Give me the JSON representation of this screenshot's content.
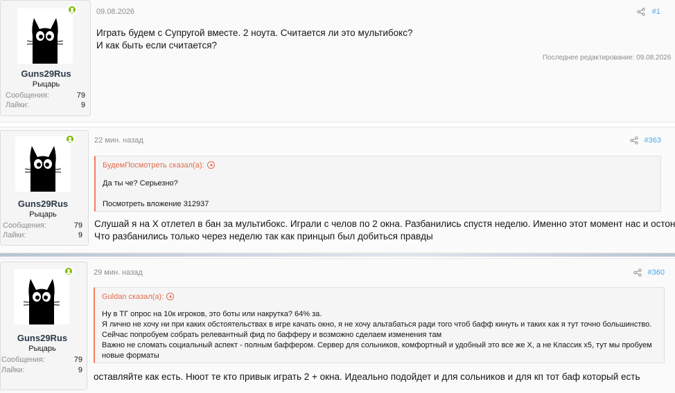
{
  "posts": [
    {
      "date": "09.08.2026",
      "number": "#1",
      "user": {
        "name": "Guns29Rus",
        "title": "Рыцарь",
        "messages_label": "Сообщения:",
        "messages": "79",
        "likes_label": "Лайки:",
        "likes": "9"
      },
      "lines": [
        "Играть будем с Супругой вместе. 2 ноута. Считается ли это мультибокс?",
        "И как быть если считается?"
      ],
      "edited": "Последнее редактирование: 09.08.2026"
    },
    {
      "date": "22 мин. назад",
      "number": "#363",
      "user": {
        "name": "Guns29Rus",
        "title": "Рыцарь",
        "messages_label": "Сообщения:",
        "messages": "79",
        "likes_label": "Лайки:",
        "likes": "9"
      },
      "quote": {
        "head": "БудемПосмотреть сказал(а):",
        "lines": [
          "Да ты че? Серьезно?",
          "Посмотреть вложение 312937"
        ]
      },
      "lines": [
        "Слушай я на Х отлетел в бан за мультибокс. Играли с челов по 2 окна. Разбанились спустя неделю. Именно этот момент нас и остоновил.",
        "Что разбанились только через неделю так как принцып был добиться правды"
      ]
    },
    {
      "date": "29 мин. назад",
      "number": "#360",
      "user": {
        "name": "Guns29Rus",
        "title": "Рыцарь",
        "messages_label": "Сообщения:",
        "messages": "79",
        "likes_label": "Лайки:",
        "likes": "9"
      },
      "quote": {
        "head": "Guldan сказал(а):",
        "lines": [
          "Ну в ТГ опрос на 10к игроков, это боты или накрутка? 64% за.",
          "Я лично не хочу ни при каких обстоятельствах в игре качать окно, я не хочу альтабаться ради того чтоб бафф кинуть и таких как я тут точно большинство.",
          "Сейчас попробуем собрать релевантный фид по бафферу и возможно сделаем изменения там",
          "Важно не сломать социальный аспект - полным баффером. Сервер для сольников, комфортный и удобный это все же Х, а не Классик х5, тут мы пробуем",
          "новые форматы"
        ]
      },
      "lines": [
        "оставляйте как есть. Нюот те кто привык играть 2 + окна. Идеально подойдет и для сольников и для кп тот баф который есть"
      ]
    }
  ],
  "colors": {
    "accent": "#47a7eb",
    "quote_accent": "#e26b4c",
    "online": "#7fb900"
  },
  "icons": [
    "share-icon",
    "online-status-icon",
    "quote-jump-icon",
    "black-cat-avatar"
  ]
}
